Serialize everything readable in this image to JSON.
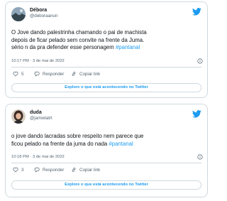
{
  "tweets": [
    {
      "display_name": "Débora",
      "handle": "@deboraanun",
      "text": "O Jove dando palestrinha chamando o pai de machista\ndepois de ficar pelado sem convite na frente da Juma.\nsério n da pra defender esse personagem ",
      "hashtag": "#pantanal",
      "timestamp": "10:17 PM · 3 de mai de 2022",
      "likes": "5",
      "reply_label": "Responder",
      "copy_label": "Copiar link",
      "explore_label": "Explore o que está acontecendo no Twitter",
      "avatar_icon": "avatar-landscape-icon"
    },
    {
      "display_name": "duda",
      "handle": "@jamietatrt",
      "text": "o jove dando lacradas sobre respeito nem parece que\nficou pelado na frente da juma do nada ",
      "hashtag": "#pantanal",
      "timestamp": "10:18 PM · 3 de mai de 2022",
      "likes": "3",
      "reply_label": "Responder",
      "copy_label": "Copiar link",
      "explore_label": "Explore o que está acontecendo no Twitter",
      "avatar_icon": "avatar-person-icon"
    }
  ],
  "colors": {
    "accent": "#1d9bf0",
    "text": "#0f1419",
    "muted": "#536471",
    "border": "#cfd9de"
  },
  "icons": [
    "twitter-bird-icon",
    "heart-icon",
    "reply-icon",
    "link-icon",
    "info-icon"
  ]
}
